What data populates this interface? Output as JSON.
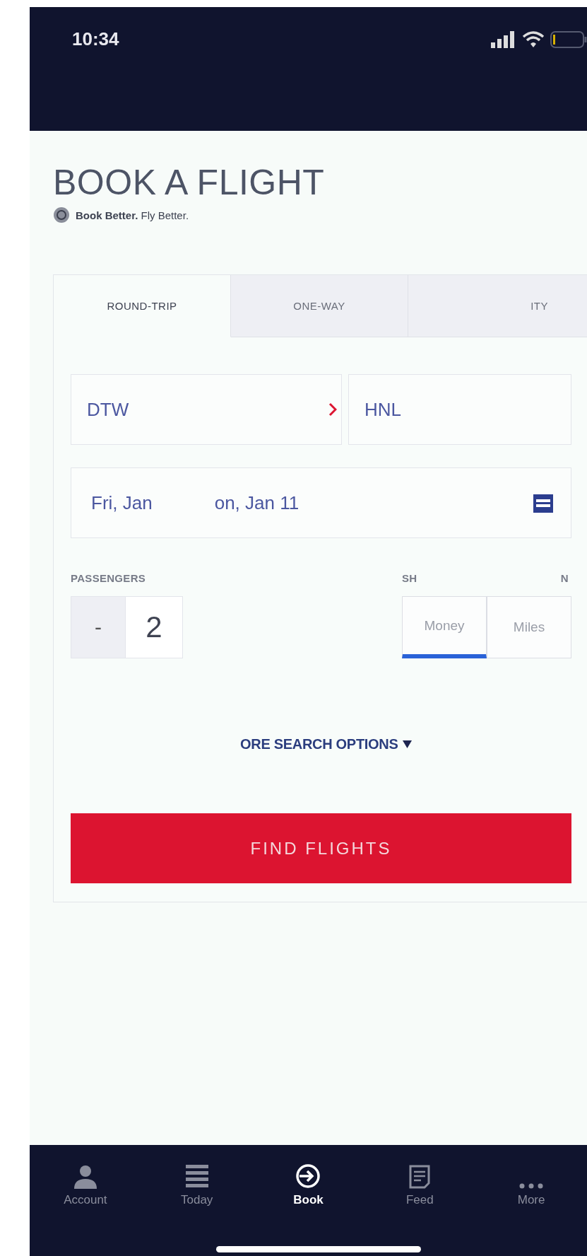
{
  "status_bar": {
    "time": "10:34"
  },
  "title": "BOOK A FLIGHT",
  "tagline": "**Book Better.** Fly Better.",
  "trip_tabs": [
    {
      "label": "ROUND-TRIP",
      "selected": true
    },
    {
      "label": "ONE-WAY",
      "selected": false
    },
    {
      "label": "ITY",
      "selected": false
    }
  ],
  "route": {
    "origin": "DTW",
    "destination": "HNL"
  },
  "dates": {
    "value_parts": [
      "Fri, Jan",
      "on, Jan 11"
    ]
  },
  "passengers": {
    "label": "PASSENGERS",
    "decrement": "-",
    "count": "2"
  },
  "price_label_parts": [
    "SH",
    "N"
  ],
  "price_options": [
    {
      "label": "Money",
      "selected": true
    },
    {
      "label": "Miles",
      "selected": false
    }
  ],
  "more_options": "ORE SEARCH OPTIONS",
  "find_button": "FIND FLIGHTS",
  "nav": [
    {
      "label": "Account",
      "kind": "account",
      "selected": false
    },
    {
      "label": "Today",
      "kind": "today",
      "selected": false
    },
    {
      "label": "Book",
      "kind": "book",
      "selected": true
    },
    {
      "label": "Feed",
      "kind": "feed",
      "selected": false
    },
    {
      "label": "More",
      "kind": "more",
      "selected": false
    }
  ]
}
